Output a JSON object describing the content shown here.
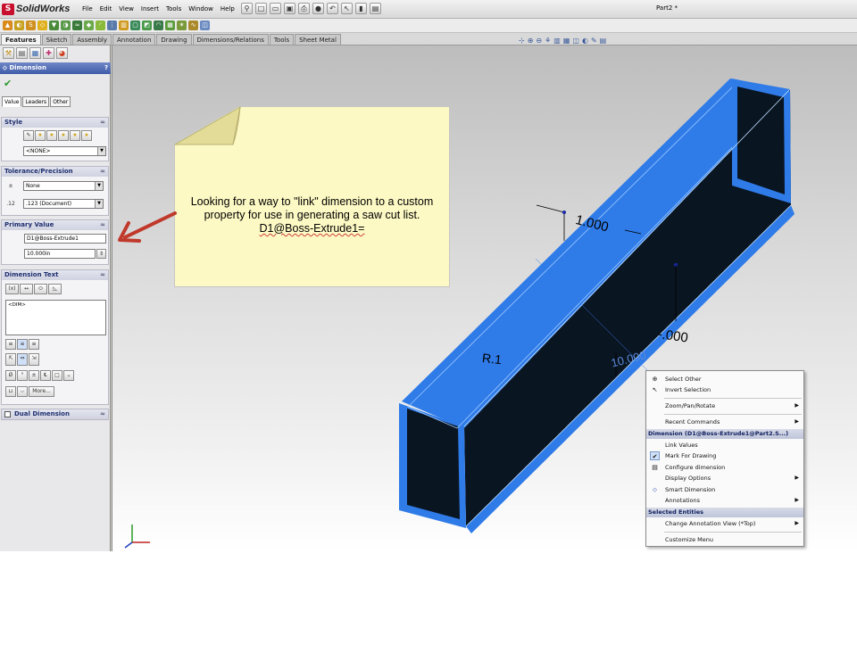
{
  "app": {
    "name": "SolidWorks",
    "document_title": "Part2 *"
  },
  "menus": [
    "File",
    "Edit",
    "View",
    "Insert",
    "Tools",
    "Window",
    "Help"
  ],
  "command_manager_tabs": [
    {
      "label": "Features",
      "active": true
    },
    {
      "label": "Sketch",
      "active": false
    },
    {
      "label": "Assembly",
      "active": false
    },
    {
      "label": "Annotation",
      "active": false
    },
    {
      "label": "Drawing",
      "active": false
    },
    {
      "label": "Dimensions/Relations",
      "active": false
    },
    {
      "label": "Tools",
      "active": false
    },
    {
      "label": "Sheet Metal",
      "active": false
    }
  ],
  "property_manager": {
    "title": "Dimension",
    "help": "?",
    "tabs": [
      "Value",
      "Leaders",
      "Other"
    ],
    "style": {
      "label": "Style",
      "selected": "<NONE>"
    },
    "tolerance": {
      "label": "Tolerance/Precision",
      "type": "None",
      "precision": ".123 (Document)"
    },
    "primary_value": {
      "label": "Primary Value",
      "name": "D1@Boss-Extrude1",
      "value": "10.000in"
    },
    "dimension_text": {
      "label": "Dimension Text",
      "content": "<DIM>",
      "more_label": "More..."
    },
    "dual_dimension": {
      "label": "Dual Dimension",
      "checked": false
    }
  },
  "note": {
    "line1": "Looking for a way to \"link\" dimension to a custom",
    "line2": "property for use in generating a saw cut list.",
    "line3": "D1@Boss-Extrude1="
  },
  "annotations": {
    "dim_top": "1.000",
    "dim_right": "-.000",
    "radius": "R.1",
    "selected_dim": "10.000"
  },
  "context_menu": {
    "items_top": [
      "Select Other",
      "Invert Selection"
    ],
    "zoom": "Zoom/Pan/Rotate",
    "recent": "Recent Commands",
    "dimension_header": "Dimension (D1@Boss-Extrude1@Part2.S...)",
    "dimension_items": [
      "Link Values",
      "Mark For Drawing",
      "Configure dimension",
      "Display Options",
      "Smart Dimension",
      "Annotations"
    ],
    "selected_header": "Selected Entities",
    "change_view": "Change Annotation View (*Top)",
    "customize": "Customize Menu"
  },
  "colors": {
    "part_blue": "#2f7be8",
    "part_dark": "#0a1522",
    "pm_header": "#3f5ba8",
    "note_fill": "#fdf9c4",
    "arrow": "#c0392b"
  }
}
